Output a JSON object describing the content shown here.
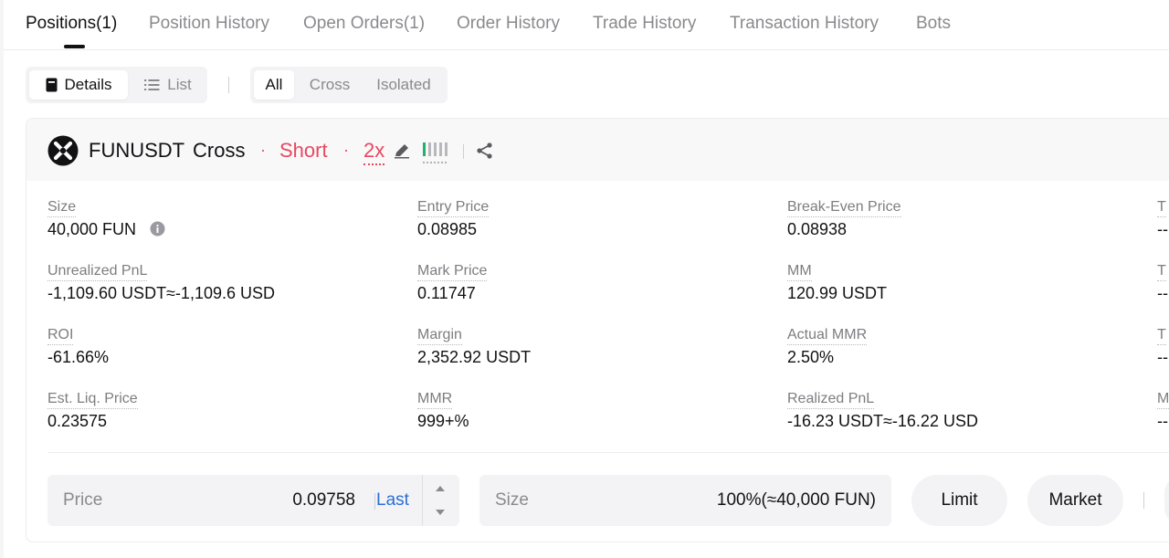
{
  "tabs": [
    {
      "label": "Positions(1)"
    },
    {
      "label": "Position History"
    },
    {
      "label": "Open Orders(1)"
    },
    {
      "label": "Order History"
    },
    {
      "label": "Trade History"
    },
    {
      "label": "Transaction History"
    },
    {
      "label": "Bots"
    }
  ],
  "view_toggle": {
    "details": "Details",
    "list": "List"
  },
  "margin_filter": {
    "all": "All",
    "cross": "Cross",
    "isolated": "Isolated"
  },
  "position": {
    "symbol": "FUNUSDT",
    "margin_mode": "Cross",
    "side": "Short",
    "leverage": "2x",
    "separator": "·"
  },
  "fields": {
    "size": {
      "label": "Size",
      "value": "40,000 FUN"
    },
    "entry_price": {
      "label": "Entry Price",
      "value": "0.08985"
    },
    "break_even": {
      "label": "Break-Even Price",
      "value": "0.08938"
    },
    "col4_row1": {
      "label": "T",
      "value": "--"
    },
    "unrealized_pnl": {
      "label": "Unrealized PnL",
      "value": "-1,109.60 USDT≈-1,109.6 USD"
    },
    "mark_price": {
      "label": "Mark Price",
      "value": "0.11747"
    },
    "mm": {
      "label": "MM",
      "value": "120.99 USDT"
    },
    "col4_row2": {
      "label": "T",
      "value": "--"
    },
    "roi": {
      "label": "ROI",
      "value": "-61.66%"
    },
    "margin": {
      "label": "Margin",
      "value": "2,352.92 USDT"
    },
    "actual_mmr": {
      "label": "Actual MMR",
      "value": "2.50%"
    },
    "col4_row3": {
      "label": "T",
      "value": "--"
    },
    "est_liq": {
      "label": "Est. Liq. Price",
      "value": "0.23575"
    },
    "mmr": {
      "label": "MMR",
      "value": "999+%"
    },
    "realized_pnl": {
      "label": "Realized PnL",
      "value": "-16.23 USDT≈-16.22 USD"
    },
    "col4_row4": {
      "label": "M",
      "value": "--"
    }
  },
  "close_form": {
    "price_label": "Price",
    "price_value": "0.09758",
    "price_source": "Last",
    "size_label": "Size",
    "size_value": "100%(≈40,000 FUN)",
    "limit_button": "Limit",
    "market_button": "Market"
  },
  "colors": {
    "loss": "#e8485f",
    "gain": "#20b26c",
    "liquidation": "#f39a3a",
    "link": "#2a6fd6"
  },
  "icons": [
    "coin-logo-icon",
    "info-icon",
    "edit-icon",
    "leverage-bars-icon",
    "share-icon",
    "caret-up-icon",
    "caret-down-icon",
    "details-icon",
    "list-icon"
  ]
}
